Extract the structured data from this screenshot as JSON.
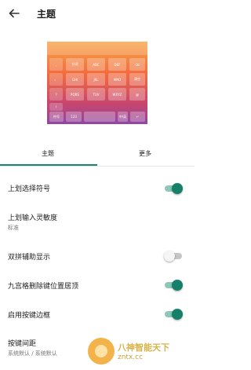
{
  "appbar": {
    "title": "主题",
    "back_icon": "arrow-left-icon"
  },
  "preview": {
    "row1": [
      "分词",
      "ABC",
      "DEF",
      "⌫"
    ],
    "row2": [
      "GHI",
      "JKL",
      "MNO",
      "清空"
    ],
    "row3": [
      "PQRS",
      "TUV",
      "WXYZ",
      "@"
    ],
    "row4": [
      "符号",
      "123",
      "",
      "中/英",
      "↵"
    ],
    "side": [
      ",",
      "。",
      "?",
      "!"
    ]
  },
  "tabs": [
    {
      "label": "主题"
    },
    {
      "label": "更多"
    }
  ],
  "colors": {
    "accent": "#16806a"
  },
  "settings": [
    {
      "label": "上划选择符号",
      "sub": "",
      "toggle": "on"
    },
    {
      "label": "上划输入灵敏度",
      "sub": "标准",
      "toggle": ""
    },
    {
      "label": "双拼辅助显示",
      "sub": "",
      "toggle": "off"
    },
    {
      "label": "九宫格删除键位置居顶",
      "sub": "",
      "toggle": "on"
    },
    {
      "label": "启用按键边框",
      "sub": "",
      "toggle": "on"
    },
    {
      "label": "按键间距",
      "sub": "系统默认 / 系统默认",
      "toggle": ""
    }
  ],
  "watermark": {
    "name": "八神智能天下",
    "url": "zntx.cc"
  }
}
